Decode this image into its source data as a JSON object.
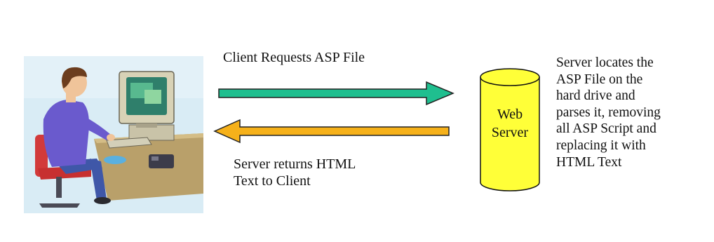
{
  "diagram": {
    "request_label": "Client Requests ASP File",
    "response_label": "Server returns HTML\nText to Client",
    "server_label": "Web\nServer",
    "server_description": "Server locates the\nASP  File on  the\nhard drive and\nparses it, removing\nall ASP Script and\nreplacing it with\nHTML Text"
  },
  "colors": {
    "request_arrow": "#1fbf8f",
    "response_arrow": "#f6b11a",
    "server_fill": "#ffff38",
    "client_accent": "#6a5acd"
  },
  "icons": {
    "client": "person-at-computer-icon",
    "server": "database-cylinder-icon"
  }
}
